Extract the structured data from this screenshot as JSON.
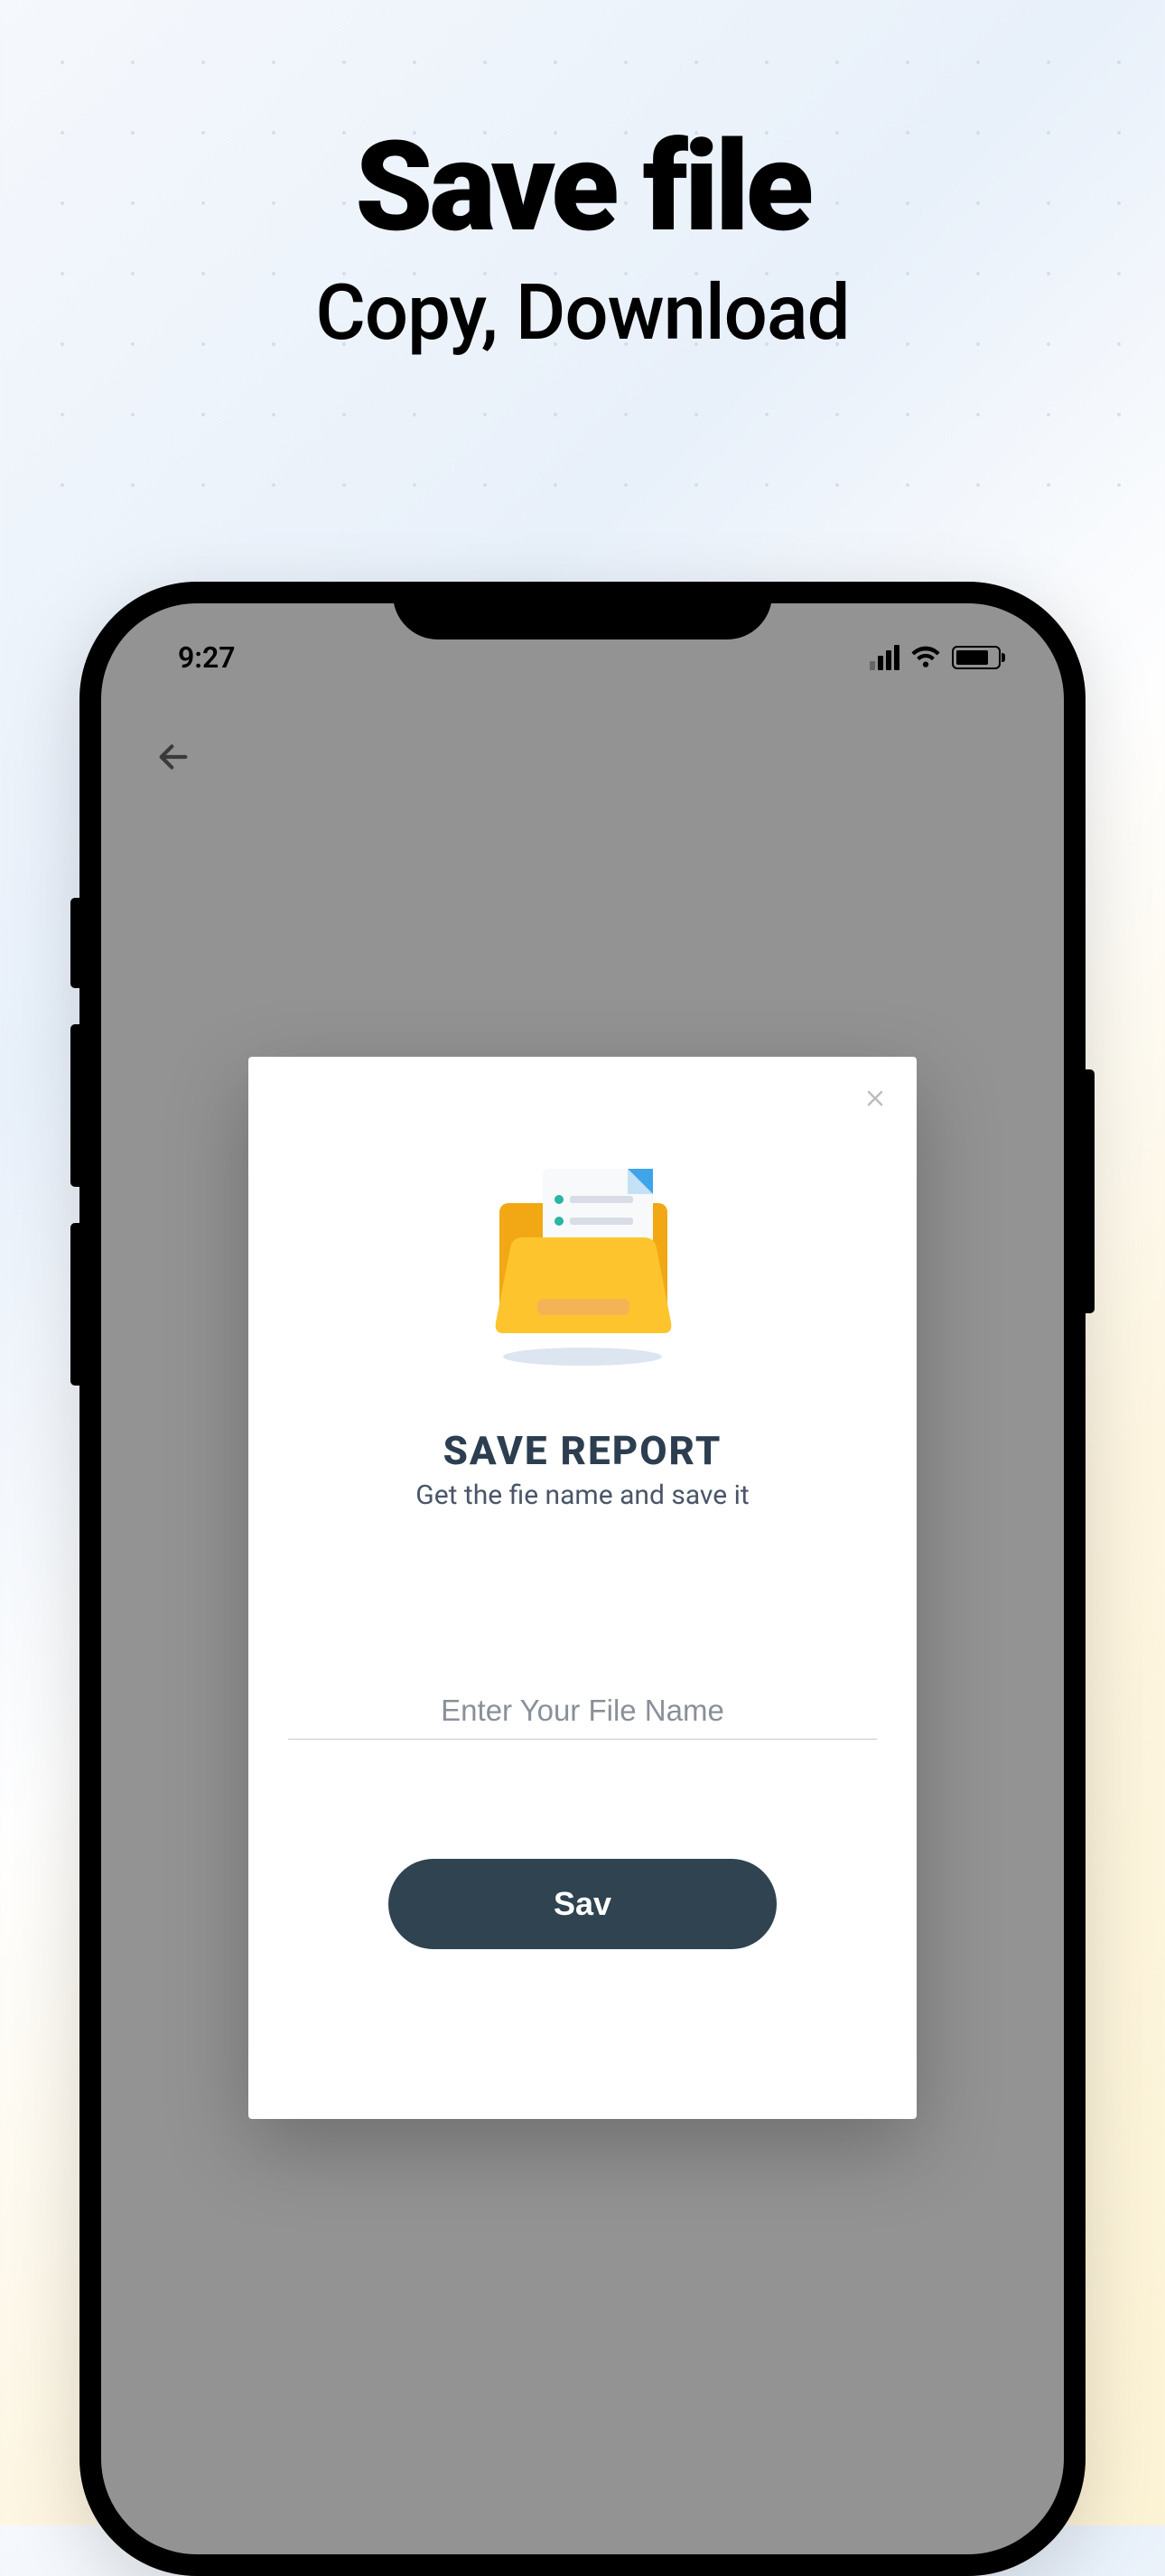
{
  "header": {
    "title": "Save file",
    "subtitle": "Copy, Download"
  },
  "status": {
    "time": "9:27"
  },
  "modal": {
    "title": "SAVE REPORT",
    "subtitle": "Get the fie name and save it",
    "input_placeholder": "Enter Your File Name",
    "save_label": "Sav"
  }
}
